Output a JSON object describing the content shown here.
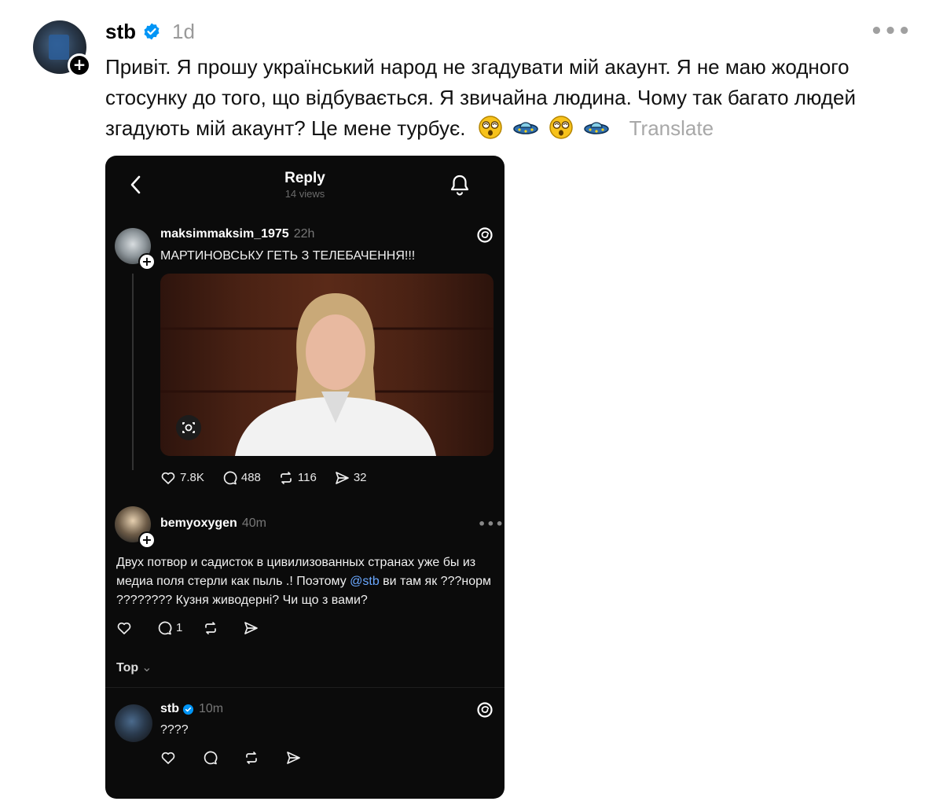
{
  "post": {
    "username": "stb",
    "time": "1d",
    "text": "Привіт. Я прошу український народ не згадувати мій акаунт. Я не маю жодного стосунку до того, що відбувається. Я звичайна людина. Чому так багато людей згадують мій акаунт? Це мене турбує.",
    "emojis": [
      "dizzy-face-icon",
      "flying-saucer-icon",
      "dizzy-face-icon",
      "flying-saucer-icon"
    ],
    "translate_label": "Translate",
    "more_label": "•••"
  },
  "screenshot": {
    "title": "Reply",
    "views": "14 views",
    "original_post": {
      "username": "maksimmaksim_1975",
      "time": "22h",
      "text": "МАРТИНОВСЬКУ ГЕТЬ З ТЕЛЕБАЧЕННЯ!!!",
      "likes": "7.8K",
      "comments": "488",
      "reposts": "116",
      "shares": "32"
    },
    "reply": {
      "username": "bemyoxygen",
      "time": "40m",
      "text_before": "Двух потвор и садисток в цивилизованных странах уже бы из медиа поля стерли как пыль .! Поэтому ",
      "mention": "@stb",
      "text_after": " ви там як ???норм ???????? Кузня живодерні? Чи що з вами?",
      "comments": "1"
    },
    "sort_label": "Top",
    "stb_reply": {
      "username": "stb",
      "time": "10m",
      "text": "????"
    }
  },
  "colors": {
    "verified": "#0095f6",
    "muted": "#9a9a9a",
    "mention": "#6aa8ff"
  }
}
